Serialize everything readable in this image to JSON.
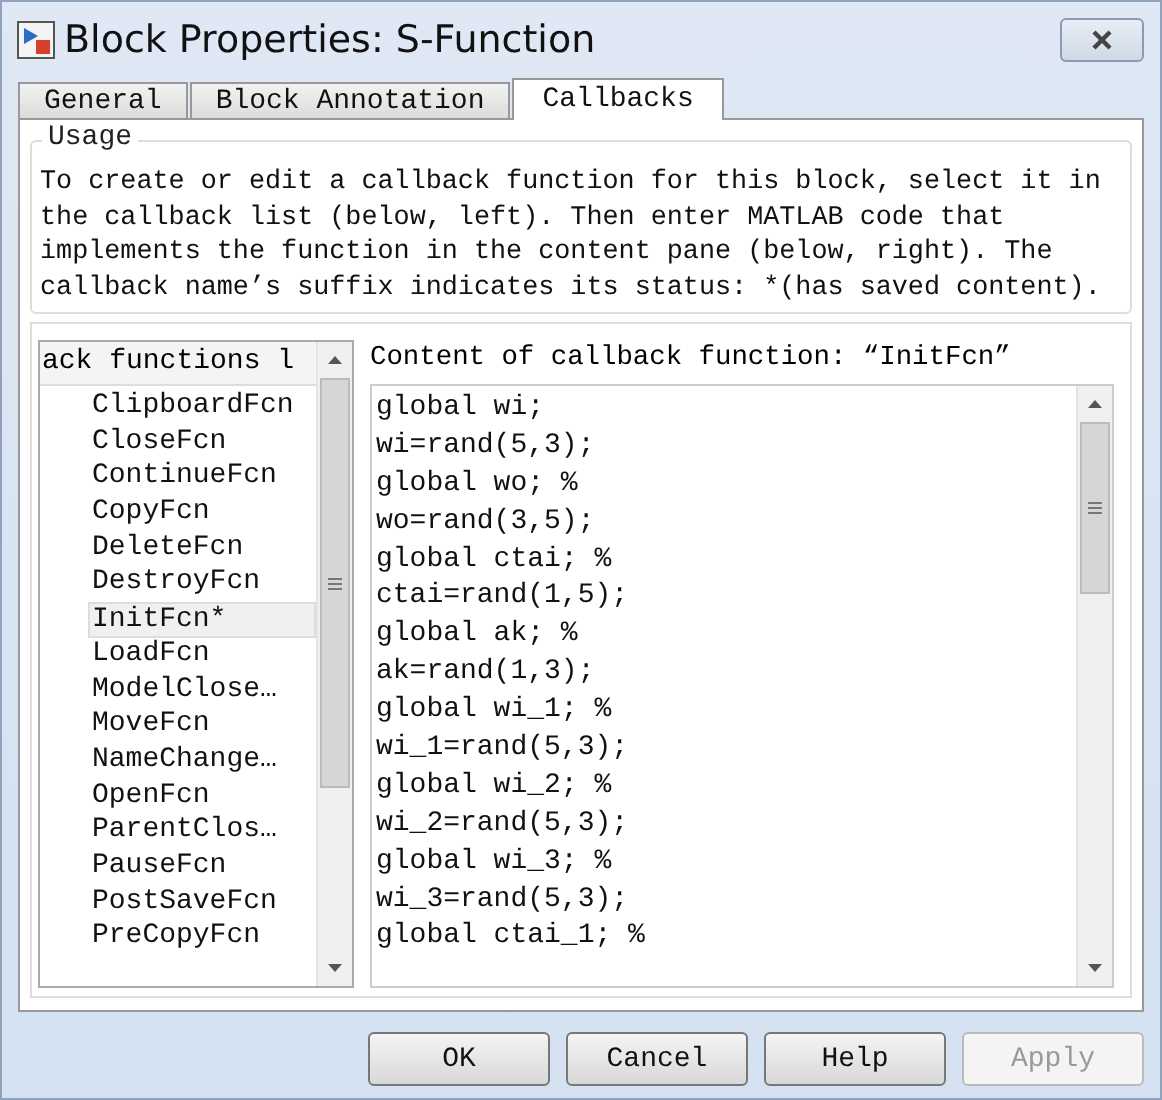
{
  "window": {
    "title": "Block Properties: S-Function"
  },
  "tabs": [
    {
      "label": "General",
      "selected": false
    },
    {
      "label": "Block Annotation",
      "selected": false
    },
    {
      "label": "Callbacks",
      "selected": true
    }
  ],
  "usage": {
    "legend": "Usage",
    "text": "To create or edit a callback function for this block, select it in the callback list (below, left). Then enter MATLAB code that implements the function in the content pane (below, right). The callback name’s suffix indicates its status: *(has saved content)."
  },
  "callback_list": {
    "header": "ack functions l",
    "items": [
      {
        "label": "ClipboardFcn",
        "selected": false
      },
      {
        "label": "CloseFcn",
        "selected": false
      },
      {
        "label": "ContinueFcn",
        "selected": false
      },
      {
        "label": "CopyFcn",
        "selected": false
      },
      {
        "label": "DeleteFcn",
        "selected": false
      },
      {
        "label": "DestroyFcn",
        "selected": false
      },
      {
        "label": "InitFcn*",
        "selected": true
      },
      {
        "label": "LoadFcn",
        "selected": false
      },
      {
        "label": "ModelClose…",
        "selected": false
      },
      {
        "label": "MoveFcn",
        "selected": false
      },
      {
        "label": "NameChange…",
        "selected": false
      },
      {
        "label": "OpenFcn",
        "selected": false
      },
      {
        "label": "ParentClos…",
        "selected": false
      },
      {
        "label": "PauseFcn",
        "selected": false
      },
      {
        "label": "PostSaveFcn",
        "selected": false
      },
      {
        "label": "PreCopyFcn",
        "selected": false
      }
    ]
  },
  "content": {
    "label": "Content of callback function: “InitFcn”",
    "lines": [
      "global wi;",
      "wi=rand(5,3);",
      "global wo; %",
      "wo=rand(3,5);",
      "global ctai; %",
      "ctai=rand(1,5);",
      "global ak; %",
      "ak=rand(1,3);",
      "global wi_1; %",
      "wi_1=rand(5,3);",
      "global wi_2; %",
      "wi_2=rand(5,3);",
      "global wi_3; %",
      "wi_3=rand(5,3);",
      "global ctai_1; %"
    ]
  },
  "buttons": [
    {
      "label": "OK",
      "disabled": false
    },
    {
      "label": "Cancel",
      "disabled": false
    },
    {
      "label": "Help",
      "disabled": false
    },
    {
      "label": "Apply",
      "disabled": true
    }
  ]
}
